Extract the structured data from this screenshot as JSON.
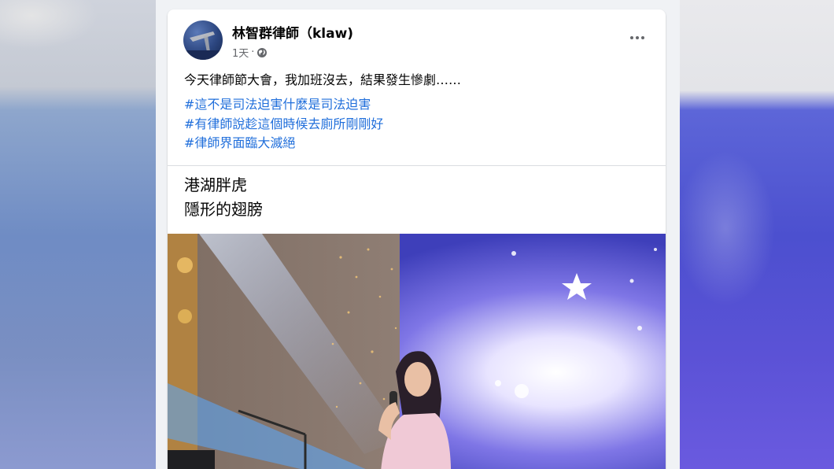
{
  "post": {
    "author": "林智群律師（klaw)",
    "timestamp": "1天",
    "separator": "·",
    "privacy_icon": "globe-icon",
    "more_icon": "more-options-icon",
    "text": "今天律師節大會，我加班沒去，結果發生慘劇……",
    "hashtags": [
      "#這不是司法迫害什麼是司法迫害",
      "#有律師說趁這個時候去廁所剛剛好",
      "#律師界面臨大滅絕"
    ],
    "video": {
      "caption_line1": "港湖胖虎",
      "caption_line2": "隱形的翅膀"
    }
  },
  "colors": {
    "link": "#216fdb",
    "text": "#050505",
    "muted": "#65676b"
  }
}
